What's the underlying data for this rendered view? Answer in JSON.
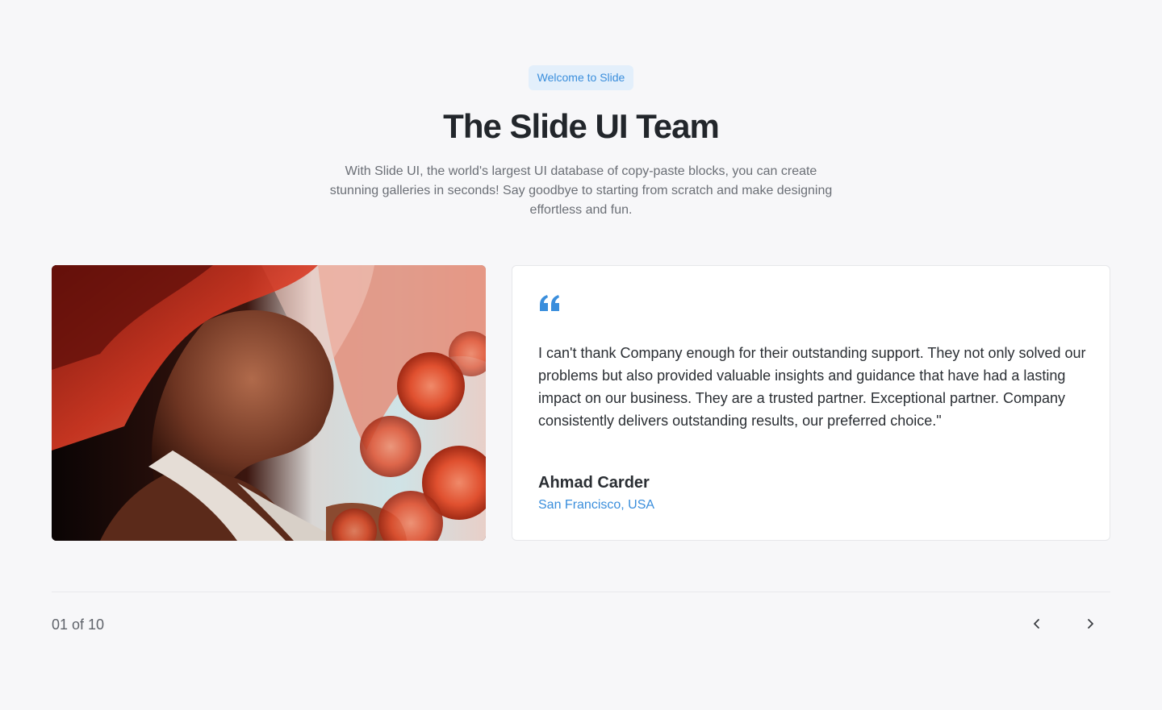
{
  "header": {
    "badge": "Welcome to Slide",
    "title": "The Slide UI Team",
    "subtitle": "With Slide UI, the world's largest UI database of copy-paste blocks, you can create stunning galleries in seconds! Say goodbye to starting from scratch and make designing effortless and fun."
  },
  "testimonial": {
    "quote": "I can't thank Company enough for their outstanding support. They not only solved our problems but also provided valuable insights and guidance that have had a lasting impact on our business. They are a trusted partner. Exceptional partner. Company consistently delivers outstanding results, our preferred choice.\"",
    "author": "Ahmad Carder",
    "location": "San Francisco, USA"
  },
  "pagination": {
    "counter": "01 of 10"
  },
  "icons": {
    "quote": "quote-icon",
    "prev": "chevron-left-icon",
    "next": "chevron-right-icon"
  },
  "colors": {
    "accent": "#3a8edc",
    "badge_bg": "#e3effb",
    "background": "#f7f7f9"
  }
}
